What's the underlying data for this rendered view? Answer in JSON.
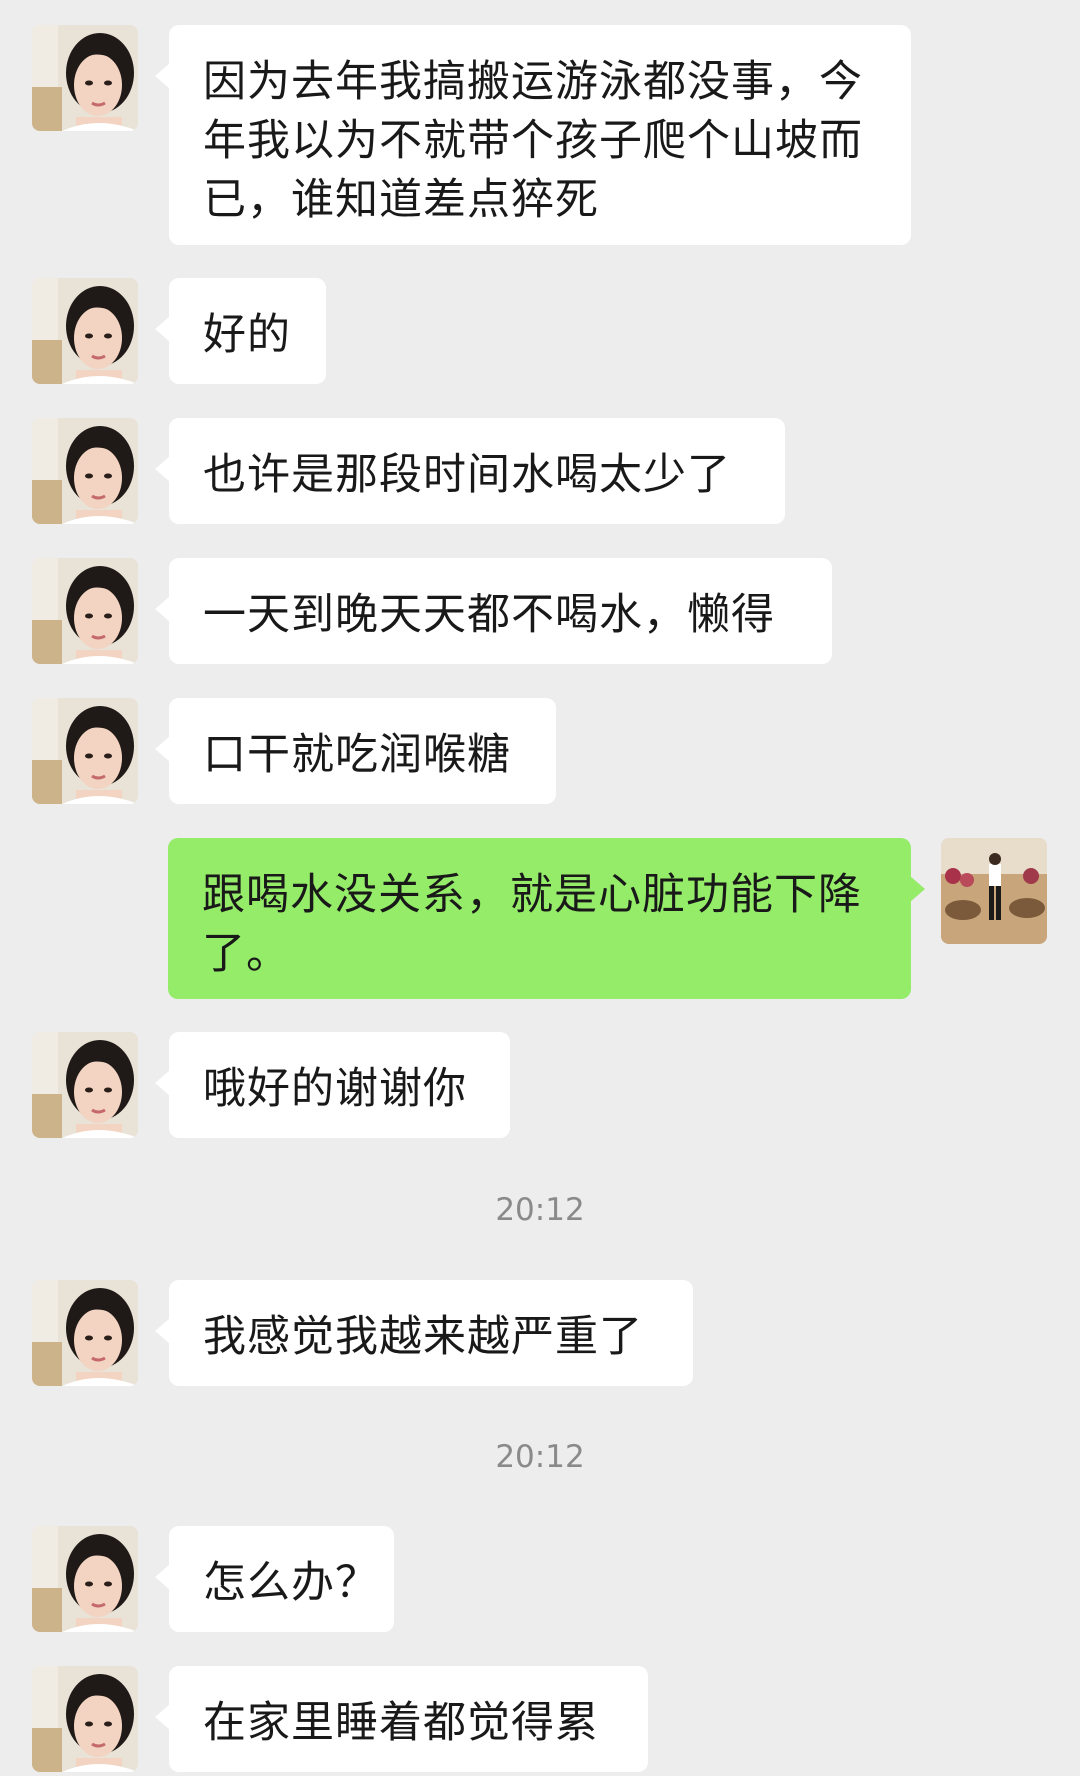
{
  "messages": [
    {
      "side": "in",
      "text": "因为去年我搞搬运游泳都没事，今年我以为不就带个孩子爬个山坡而已，谁知道差点猝死"
    },
    {
      "side": "in",
      "text": "好的"
    },
    {
      "side": "in",
      "text": "也许是那段时间水喝太少了"
    },
    {
      "side": "in",
      "text": "一天到晚天天都不喝水，懒得"
    },
    {
      "side": "in",
      "text": "口干就吃润喉糖"
    },
    {
      "side": "out",
      "text": "跟喝水没关系，就是心脏功能下降了。"
    },
    {
      "side": "in",
      "text": "哦好的谢谢你"
    },
    {
      "side": "in",
      "text": "我感觉我越来越严重了"
    },
    {
      "side": "in",
      "text": "怎么办？"
    },
    {
      "side": "in",
      "text": "在家里睡着都觉得累"
    }
  ],
  "timestamps": [
    "20:12",
    "20:12"
  ],
  "colors": {
    "background": "#ededed",
    "incoming_bubble": "#ffffff",
    "outgoing_bubble": "#95ec69",
    "timestamp_text": "#8a8a8a"
  },
  "icons": {
    "contact_avatar": "woman-portrait-avatar",
    "self_avatar": "desert-camel-photo-avatar"
  }
}
